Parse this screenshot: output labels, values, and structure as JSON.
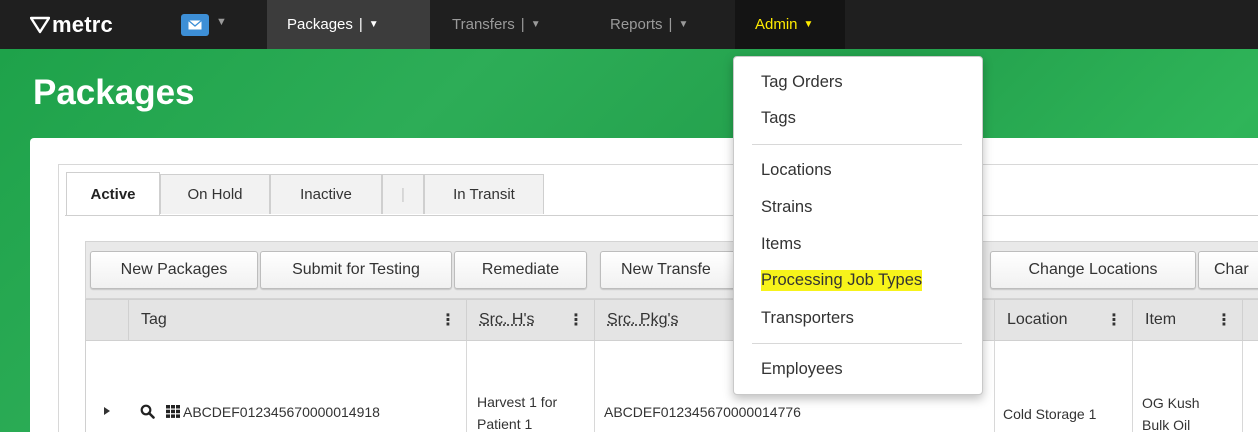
{
  "nav": {
    "logo_text": "metrc",
    "packages_label": "Packages",
    "transfers_label": "Transfers",
    "reports_label": "Reports",
    "admin_label": "Admin",
    "admin_color": "#ffeb00"
  },
  "page": {
    "title": "Packages"
  },
  "tabs": [
    {
      "label": "Active"
    },
    {
      "label": "On Hold"
    },
    {
      "label": "Inactive"
    },
    {
      "label": "|"
    },
    {
      "label": "In Transit"
    }
  ],
  "toolbar": {
    "new_packages": "New Packages",
    "submit_testing": "Submit for Testing",
    "remediate": "Remediate",
    "new_transfer": "New Transfe",
    "change_locations": "Change Locations",
    "change_more": "Char"
  },
  "grid": {
    "columns": {
      "tag": "Tag",
      "src_hs": "Src. H's",
      "src_pkgs": "Src. Pkg's",
      "location": "Location",
      "item": "Item"
    },
    "row": {
      "tag": "ABCDEF012345670000014918",
      "src_h_line1": "Harvest 1 for",
      "src_h_line2": "Patient 1",
      "src_pkg": "ABCDEF012345670000014776",
      "location": "Cold Storage 1",
      "item_line1": "OG Kush",
      "item_line2": "Bulk Oil"
    }
  },
  "admin_menu": {
    "tag_orders": "Tag Orders",
    "tags": "Tags",
    "locations": "Locations",
    "strains": "Strains",
    "items": "Items",
    "processing_job_types": "Processing Job Types",
    "transporters": "Transporters",
    "employees": "Employees",
    "highlight_color": "#f7f31a"
  },
  "icons": {
    "logo": "metrc-logo-icon",
    "messages": "envelope-icon",
    "expand": "caret-right-icon",
    "search": "magnifier-icon",
    "grid": "grid-icon",
    "column_menu": "vertical-dots-icon"
  }
}
